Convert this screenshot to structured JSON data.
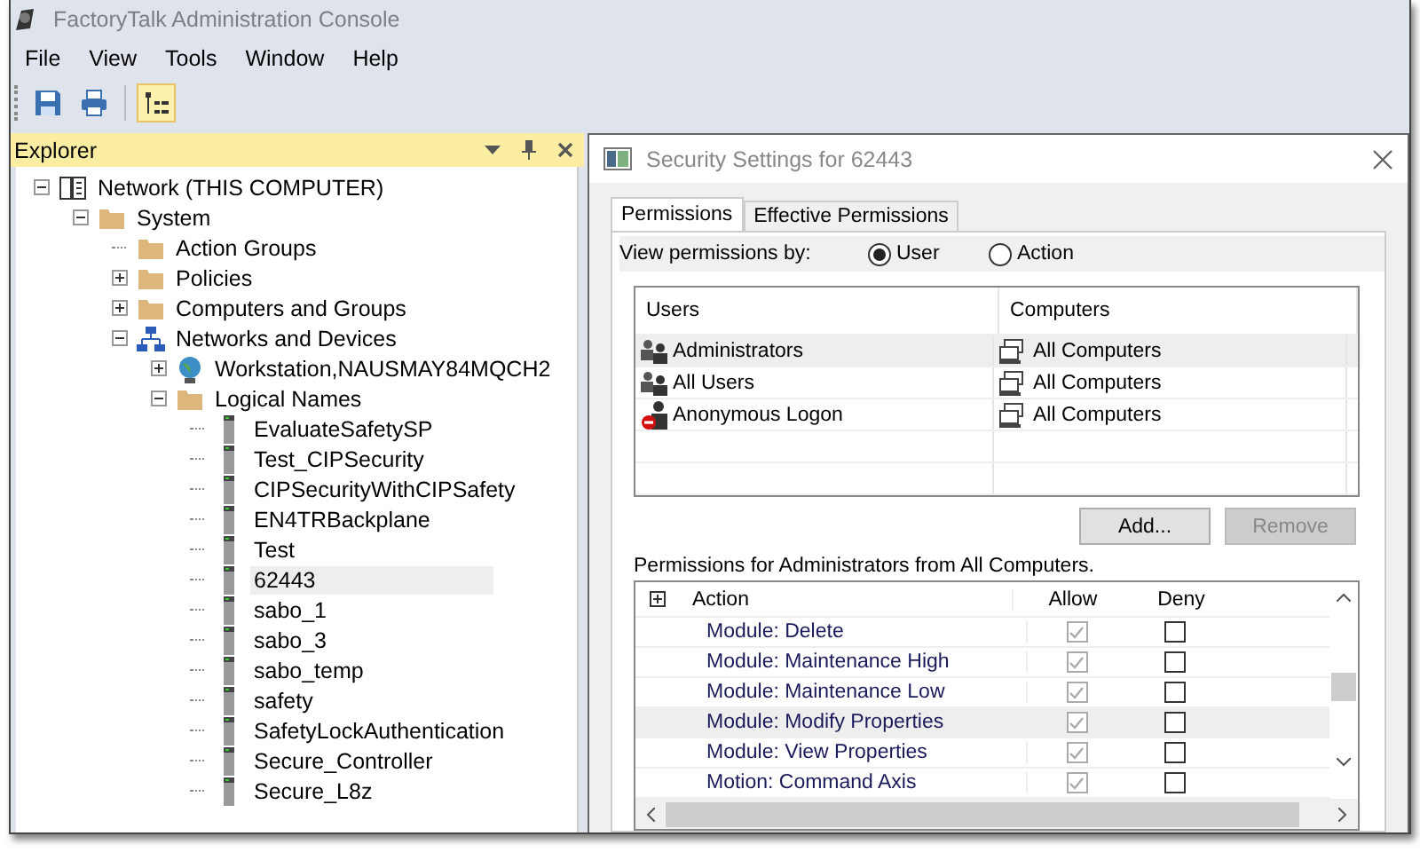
{
  "window": {
    "title": "FactoryTalk Administration Console"
  },
  "menu": [
    "File",
    "View",
    "Tools",
    "Window",
    "Help"
  ],
  "toolbar": [
    {
      "kind": "save",
      "on": false
    },
    {
      "kind": "print",
      "on": false
    },
    {
      "kind": "tree",
      "on": true
    }
  ],
  "explorer": {
    "title": "Explorer",
    "tree": [
      {
        "label": "Network (THIS COMPUTER)",
        "kind": "network",
        "expanded": true,
        "selected": false,
        "children": [
          {
            "label": "System",
            "kind": "folder",
            "expanded": true,
            "selected": false,
            "children": [
              {
                "label": "Action Groups",
                "kind": "folder",
                "selected": false
              },
              {
                "label": "Policies",
                "kind": "folder",
                "expanded": false,
                "selected": false
              },
              {
                "label": "Computers and Groups",
                "kind": "folder",
                "expanded": false,
                "selected": false
              },
              {
                "label": "Networks and Devices",
                "kind": "devices",
                "expanded": true,
                "selected": false,
                "children": [
                  {
                    "label": "Workstation,NAUSMAY84MQCH2",
                    "kind": "workstation",
                    "expanded": false,
                    "selected": false
                  },
                  {
                    "label": "Logical Names",
                    "kind": "folder",
                    "expanded": true,
                    "selected": false,
                    "children": [
                      {
                        "label": "EvaluateSafetySP",
                        "kind": "device",
                        "selected": false
                      },
                      {
                        "label": "Test_CIPSecurity",
                        "kind": "device",
                        "selected": false
                      },
                      {
                        "label": "CIPSecurityWithCIPSafety",
                        "kind": "device",
                        "selected": false
                      },
                      {
                        "label": "EN4TRBackplane",
                        "kind": "device",
                        "selected": false
                      },
                      {
                        "label": "Test",
                        "kind": "device",
                        "selected": false
                      },
                      {
                        "label": "62443",
                        "kind": "device",
                        "selected": true
                      },
                      {
                        "label": "sabo_1",
                        "kind": "device",
                        "selected": false
                      },
                      {
                        "label": "sabo_3",
                        "kind": "device",
                        "selected": false
                      },
                      {
                        "label": "sabo_temp",
                        "kind": "device",
                        "selected": false
                      },
                      {
                        "label": "safety",
                        "kind": "device",
                        "selected": false
                      },
                      {
                        "label": "SafetyLockAuthentication",
                        "kind": "device",
                        "selected": false
                      },
                      {
                        "label": "Secure_Controller",
                        "kind": "device",
                        "selected": false
                      },
                      {
                        "label": "Secure_L8z",
                        "kind": "device",
                        "selected": false
                      }
                    ]
                  }
                ]
              }
            ]
          }
        ]
      }
    ]
  },
  "dialog": {
    "title": "Security Settings for 62443",
    "tabs": [
      {
        "label": "Permissions",
        "selected": true
      },
      {
        "label": "Effective Permissions",
        "selected": false
      }
    ],
    "view_by": {
      "label": "View permissions by:",
      "options": [
        {
          "label": "User",
          "selected": true
        },
        {
          "label": "Action",
          "selected": false
        }
      ]
    },
    "users_table": {
      "columns": [
        "Users",
        "Computers"
      ],
      "rows": [
        {
          "user": "Administrators",
          "kind": "group",
          "computers": "All Computers",
          "selected": true
        },
        {
          "user": "All Users",
          "kind": "group",
          "computers": "All Computers",
          "selected": false
        },
        {
          "user": "Anonymous Logon",
          "kind": "anonymous",
          "computers": "All Computers",
          "selected": false
        }
      ]
    },
    "buttons": [
      {
        "label": "Add...",
        "disabled": false
      },
      {
        "label": "Remove",
        "disabled": true
      }
    ],
    "permissions_label": "Permissions for Administrators from All Computers.",
    "permissions": {
      "columns": [
        "Action",
        "Allow",
        "Deny"
      ],
      "rows": [
        {
          "action": "Module: Delete",
          "allow": true,
          "deny": false,
          "selected": false
        },
        {
          "action": "Module: Maintenance High",
          "allow": true,
          "deny": false,
          "selected": false
        },
        {
          "action": "Module: Maintenance Low",
          "allow": true,
          "deny": false,
          "selected": false
        },
        {
          "action": "Module: Modify Properties",
          "allow": true,
          "deny": false,
          "selected": true
        },
        {
          "action": "Module: View Properties",
          "allow": true,
          "deny": false,
          "selected": false
        },
        {
          "action": "Motion: Command Axis",
          "allow": true,
          "deny": false,
          "selected": false
        }
      ]
    }
  }
}
